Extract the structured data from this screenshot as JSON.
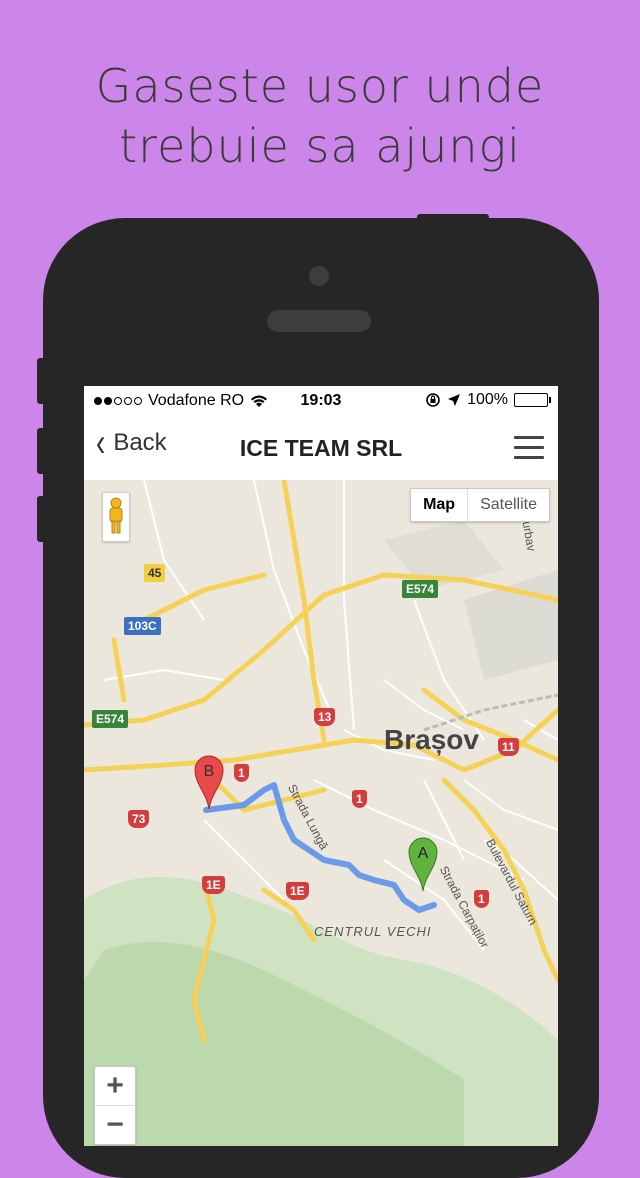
{
  "headline": {
    "line1": "Gaseste usor unde",
    "line2": "trebuie sa ajungi"
  },
  "status_bar": {
    "carrier": "Vodafone RO",
    "time": "19:03",
    "battery": "100%",
    "signal_bars_filled": 2,
    "signal_bars_total": 5
  },
  "nav": {
    "back_label": "Back",
    "title": "ICE TEAM SRL"
  },
  "map": {
    "toggle": {
      "map_label": "Map",
      "satellite_label": "Satellite",
      "selected": "Map"
    },
    "city_label": "Brașov",
    "district_label": "CENTRUL VECHI",
    "streets": {
      "strada_lunga": "Strada Lungă",
      "strada_carpatilor": "Strada Carpaților",
      "bulevardul_saturn": "Bulevardul Saturn",
      "durbav": "Durbav"
    },
    "route_shields": {
      "e574_top": "E574",
      "e574_left": "E574",
      "r45": "45",
      "r103c": "103C",
      "r13": "13",
      "r11": "11",
      "r1_a": "1",
      "r1_b": "1",
      "r1_c": "1",
      "r73": "73",
      "r1e_a": "1E",
      "r1e_b": "1E"
    },
    "markers": {
      "start": "A",
      "end": "B"
    },
    "zoom": {
      "in_label": "+",
      "out_label": "−"
    },
    "colors": {
      "route": "#6b9be8",
      "major_road": "#f5d257",
      "marker_a": "#5fb33e",
      "marker_b": "#e8494a",
      "park": "#cfe2c2"
    }
  },
  "colors": {
    "background": "#cc86ea",
    "phone": "#262626"
  }
}
